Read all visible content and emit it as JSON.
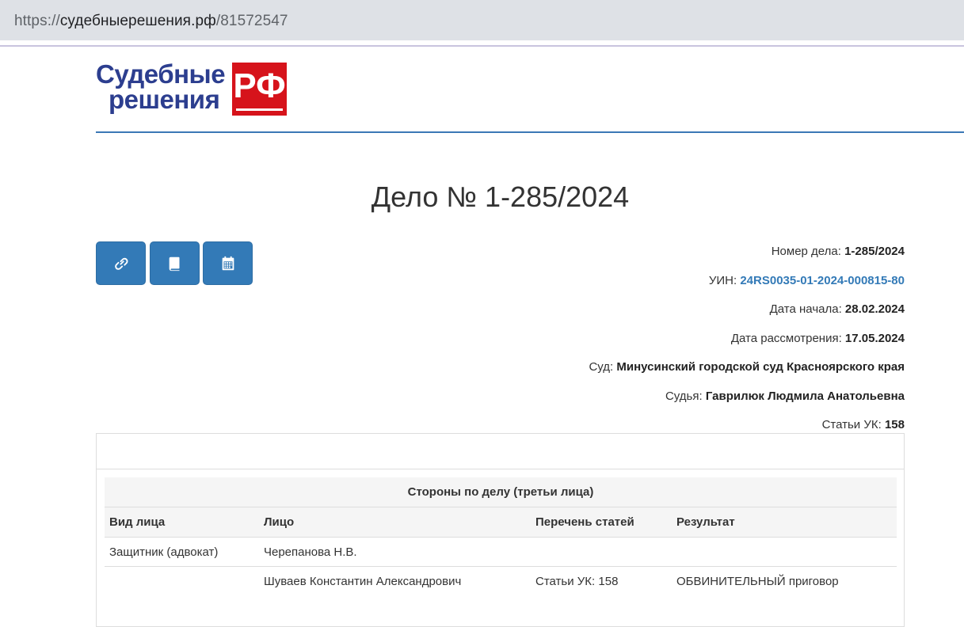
{
  "browser": {
    "url_scheme": "https://",
    "url_host": "судебныерешения.рф",
    "url_path": "/81572547"
  },
  "logo": {
    "line1": "Судебные",
    "line2": "решения",
    "badge": "РФ",
    "badge_color": "#d6131b",
    "text_color": "#2c3e8f"
  },
  "case": {
    "title": "Дело № 1-285/2024"
  },
  "toolbar": {
    "buttons": [
      {
        "icon": "link-icon"
      },
      {
        "icon": "book-icon"
      },
      {
        "icon": "calendar-icon"
      }
    ]
  },
  "info": {
    "case_number_label": "Номер дела:",
    "case_number_value": "1-285/2024",
    "uin_label": "УИН:",
    "uin_value": "24RS0035-01-2024-000815-80",
    "start_date_label": "Дата начала:",
    "start_date_value": "28.02.2024",
    "review_date_label": "Дата рассмотрения:",
    "review_date_value": "17.05.2024",
    "court_label": "Суд:",
    "court_value": "Минусинский городской суд Красноярского края",
    "judge_label": "Судья:",
    "judge_value": "Гаврилюк Людмила Анатольевна",
    "articles_label": "Статьи УК:",
    "articles_value": "158"
  },
  "parties": {
    "caption": "Стороны по делу (третьи лица)",
    "headers": [
      "Вид лица",
      "Лицо",
      "Перечень статей",
      "Результат"
    ],
    "rows": [
      [
        "Защитник (адвокат)",
        "Черепанова Н.В.",
        "",
        ""
      ],
      [
        "",
        "Шуваев Константин Александрович",
        "Статьи УК: 158",
        "ОБВИНИТЕЛЬНЫЙ приговор"
      ]
    ]
  },
  "colors": {
    "accent": "#337ab7",
    "rule": "#3b78b6"
  }
}
